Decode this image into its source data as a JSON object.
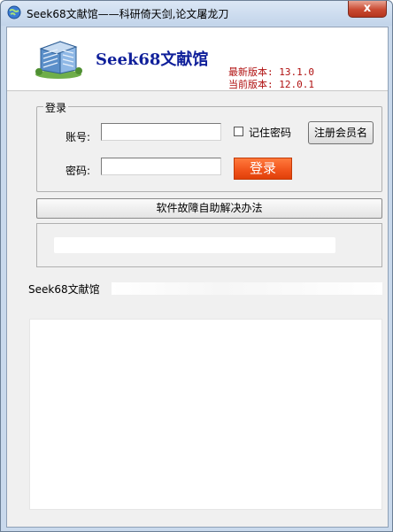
{
  "window": {
    "title": "Seek68文献馆——科研倚天剑,论文屠龙刀",
    "close_label": "x"
  },
  "header": {
    "app_name": "Seek68文献馆",
    "latest_version": "最新版本: 13.1.0",
    "current_version": "当前版本: 12.0.1"
  },
  "login": {
    "group_title": "登录",
    "account_label": "账号:",
    "account_value": "",
    "password_label": "密码:",
    "password_value": "",
    "remember_label": "记住密码",
    "remember_checked": false,
    "register_label": "注册会员名",
    "login_label": "登录"
  },
  "help": {
    "fault_label": "软件故障自助解决办法"
  },
  "status": {
    "text": "Seek68文献馆"
  },
  "colors": {
    "brand_blue": "#0f1f9a",
    "version_red": "#b01010",
    "login_orange": "#f0521a"
  }
}
